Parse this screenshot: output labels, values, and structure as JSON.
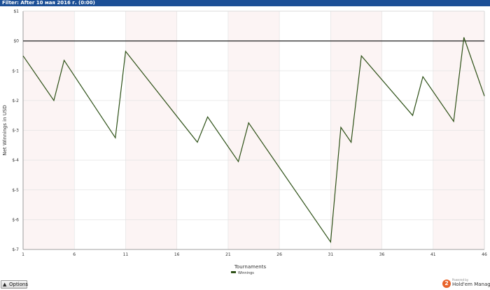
{
  "filter": {
    "text": "Filter: After 10 мая 2016 г. (0:00)"
  },
  "chart_data": {
    "type": "line",
    "title": "",
    "xlabel": "Tournaments",
    "ylabel": "Net Winnings in USD",
    "xlim": [
      1,
      46
    ],
    "ylim": [
      -7,
      1
    ],
    "x_ticks": [
      "1",
      "6",
      "11",
      "16",
      "21",
      "26",
      "31",
      "36",
      "41",
      "46"
    ],
    "y_ticks": [
      "$1",
      "$0",
      "$-1",
      "$-2",
      "$-3",
      "$-4",
      "$-5",
      "$-6",
      "$-7"
    ],
    "grid": true,
    "legend": "bottom-center",
    "series": [
      {
        "name": "Winnings",
        "color": "#2d5016",
        "x": [
          1,
          4,
          5,
          10,
          11,
          18,
          19,
          22,
          23,
          31,
          32,
          33,
          34,
          39,
          40,
          43,
          44,
          46
        ],
        "y": [
          -0.5,
          -2.0,
          -0.65,
          -3.25,
          -0.35,
          -3.4,
          -2.55,
          -4.05,
          -2.75,
          -6.75,
          -2.9,
          -3.4,
          -0.5,
          -2.5,
          -1.2,
          -2.7,
          0.12,
          -1.85
        ]
      }
    ]
  },
  "footer": {
    "options_label": "Options",
    "options_icon": "triangle-up-icon",
    "brand_small": "Powered by",
    "brand_name": "Hold'em Manager",
    "brand_icon": "hem-logo-icon",
    "brand_badge": "2"
  }
}
